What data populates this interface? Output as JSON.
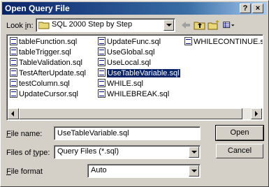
{
  "window": {
    "title": "Open Query File"
  },
  "title_buttons": {
    "help": "?",
    "close": "×"
  },
  "look_in": {
    "label_pre": "Look ",
    "label_u": "i",
    "label_post": "n:",
    "value": "SQL 2000 Step by Step"
  },
  "files": {
    "col1": [
      "tableFunction.sql",
      "tableTrigger.sql",
      "TableValidation.sql",
      "TestAfterUpdate.sql",
      "testColumn.sql",
      "UpdateCursor.sql"
    ],
    "col2": [
      "UpdateFunc.sql",
      "UseGlobal.sql",
      "UseLocal.sql",
      "UseTableVariable.sql",
      "WHILE.sql",
      "WHILEBREAK.sql"
    ],
    "col3": [
      "WHILECONTINUE.sql"
    ]
  },
  "file_name": {
    "label_u": "F",
    "label_post": "ile name:",
    "value": "UseTableVariable.sql"
  },
  "file_type": {
    "label_pre": "Files of ",
    "label_u": "t",
    "label_post": "ype:",
    "value": "Query Files (*.sql)"
  },
  "file_format": {
    "label_u": "F",
    "label_post": "ile format",
    "value": "Auto"
  },
  "buttons": {
    "open": "Open",
    "cancel": "Cancel"
  }
}
